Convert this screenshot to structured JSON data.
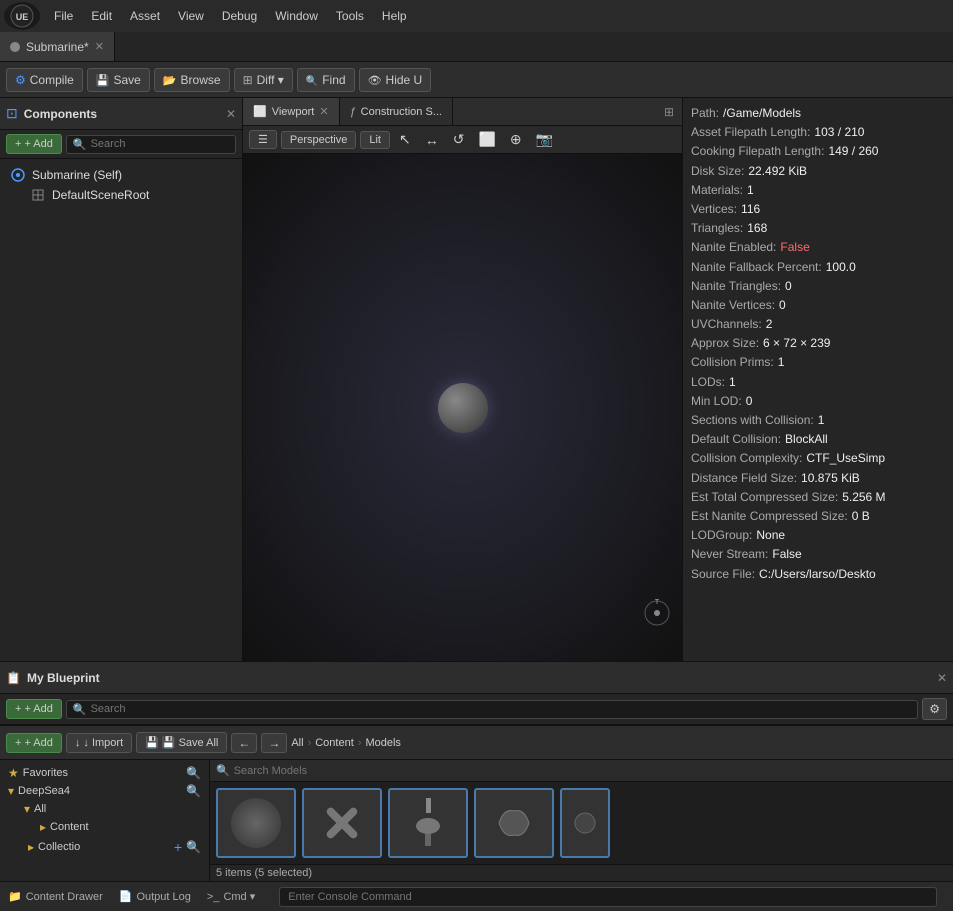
{
  "menubar": {
    "logo": "UE",
    "items": [
      "File",
      "Edit",
      "Asset",
      "View",
      "Debug",
      "Window",
      "Tools",
      "Help"
    ]
  },
  "tabs": [
    {
      "label": "Submarine*",
      "icon": "⬡",
      "active": true
    }
  ],
  "toolbar": {
    "compile_label": "Compile",
    "save_label": "Save",
    "browse_label": "Browse",
    "diff_label": "Diff ▾",
    "find_label": "Find",
    "hide_label": "Hide U"
  },
  "components_panel": {
    "title": "Components",
    "add_label": "+ Add",
    "search_placeholder": "Search",
    "items": [
      {
        "label": "Submarine (Self)",
        "icon": "●",
        "type": "component"
      },
      {
        "label": "DefaultSceneRoot",
        "icon": "⊕",
        "type": "scene-root",
        "indent": true
      }
    ]
  },
  "viewport": {
    "tabs": [
      {
        "label": "Viewport",
        "icon": "⬜",
        "active": true
      },
      {
        "label": "Construction S...",
        "icon": "ƒ",
        "active": false
      }
    ],
    "perspective_label": "Perspective",
    "lit_label": "Lit",
    "toolbar_icons": [
      "↖",
      "↔",
      "↺",
      "⬜",
      "⊕",
      "⋮"
    ]
  },
  "blueprint_panel": {
    "title": "My Blueprint",
    "add_label": "+ Add",
    "search_placeholder": "Search"
  },
  "content_browser": {
    "add_label": "+ Add",
    "import_label": "↓ Import",
    "save_all_label": "💾 Save All",
    "breadcrumb": [
      "All",
      "Content",
      "Models"
    ],
    "search_placeholder": "Search Models",
    "sidebar": {
      "favorites": {
        "label": "Favorites",
        "expanded": false
      },
      "deepsea4": {
        "label": "DeepSea4",
        "expanded": true,
        "children": [
          {
            "label": "All",
            "expanded": true,
            "children": [
              {
                "label": "Content",
                "expanded": false
              }
            ]
          },
          {
            "label": "Collectio",
            "expanded": false
          }
        ]
      }
    },
    "assets": [
      {
        "type": "sphere",
        "id": 1
      },
      {
        "type": "propeller",
        "id": 2
      },
      {
        "type": "lamp",
        "id": 3
      },
      {
        "type": "part1",
        "id": 4
      },
      {
        "type": "part2",
        "id": 5
      }
    ],
    "selection_count": "5 items (5 selected)"
  },
  "info_panel": {
    "rows": [
      {
        "key": "Path:",
        "val": "/Game/Models",
        "highlight": false
      },
      {
        "key": "Asset Filepath Length:",
        "val": "103 / 210",
        "highlight": false
      },
      {
        "key": "Cooking Filepath Length:",
        "val": "149 / 260",
        "highlight": false
      },
      {
        "key": "Disk Size:",
        "val": "22.492 KiB",
        "highlight": false
      },
      {
        "key": "Materials:",
        "val": "1",
        "highlight": false
      },
      {
        "key": "Vertices:",
        "val": "116",
        "highlight": false
      },
      {
        "key": "Triangles:",
        "val": "168",
        "highlight": false
      },
      {
        "key": "Nanite Enabled:",
        "val": "False",
        "highlight": true
      },
      {
        "key": "Nanite Fallback Percent:",
        "val": "100.0",
        "highlight": false
      },
      {
        "key": "Nanite Triangles:",
        "val": "0",
        "highlight": false
      },
      {
        "key": "Nanite Vertices:",
        "val": "0",
        "highlight": false
      },
      {
        "key": "UVChannels:",
        "val": "2",
        "highlight": false
      },
      {
        "key": "Approx Size:",
        "val": "6 × 72 × 239",
        "highlight": false
      },
      {
        "key": "Collision Prims:",
        "val": "1",
        "highlight": false
      },
      {
        "key": "LODs:",
        "val": "1",
        "highlight": false
      },
      {
        "key": "Min LOD:",
        "val": "0",
        "highlight": false
      },
      {
        "key": "Sections with Collision:",
        "val": "1",
        "highlight": false
      },
      {
        "key": "Default Collision:",
        "val": "BlockAll",
        "highlight": false
      },
      {
        "key": "Collision Complexity:",
        "val": "CTF_UseSimp",
        "highlight": false
      },
      {
        "key": "Distance Field Size:",
        "val": "10.875 KiB",
        "highlight": false
      },
      {
        "key": "Est Total Compressed Size:",
        "val": "5.256 M",
        "highlight": false
      },
      {
        "key": "Est Nanite Compressed Size:",
        "val": "0 B",
        "highlight": false
      },
      {
        "key": "LODGroup:",
        "val": "None",
        "highlight": false
      },
      {
        "key": "Never Stream:",
        "val": "False",
        "highlight": false
      },
      {
        "key": "Source File:",
        "val": "C:/Users/larso/Deskto",
        "highlight": false
      }
    ]
  },
  "statusbar": {
    "content_drawer": "Content Drawer",
    "output_log": "Output Log",
    "cmd_label": "Cmd ▾",
    "console_placeholder": "Enter Console Command"
  }
}
